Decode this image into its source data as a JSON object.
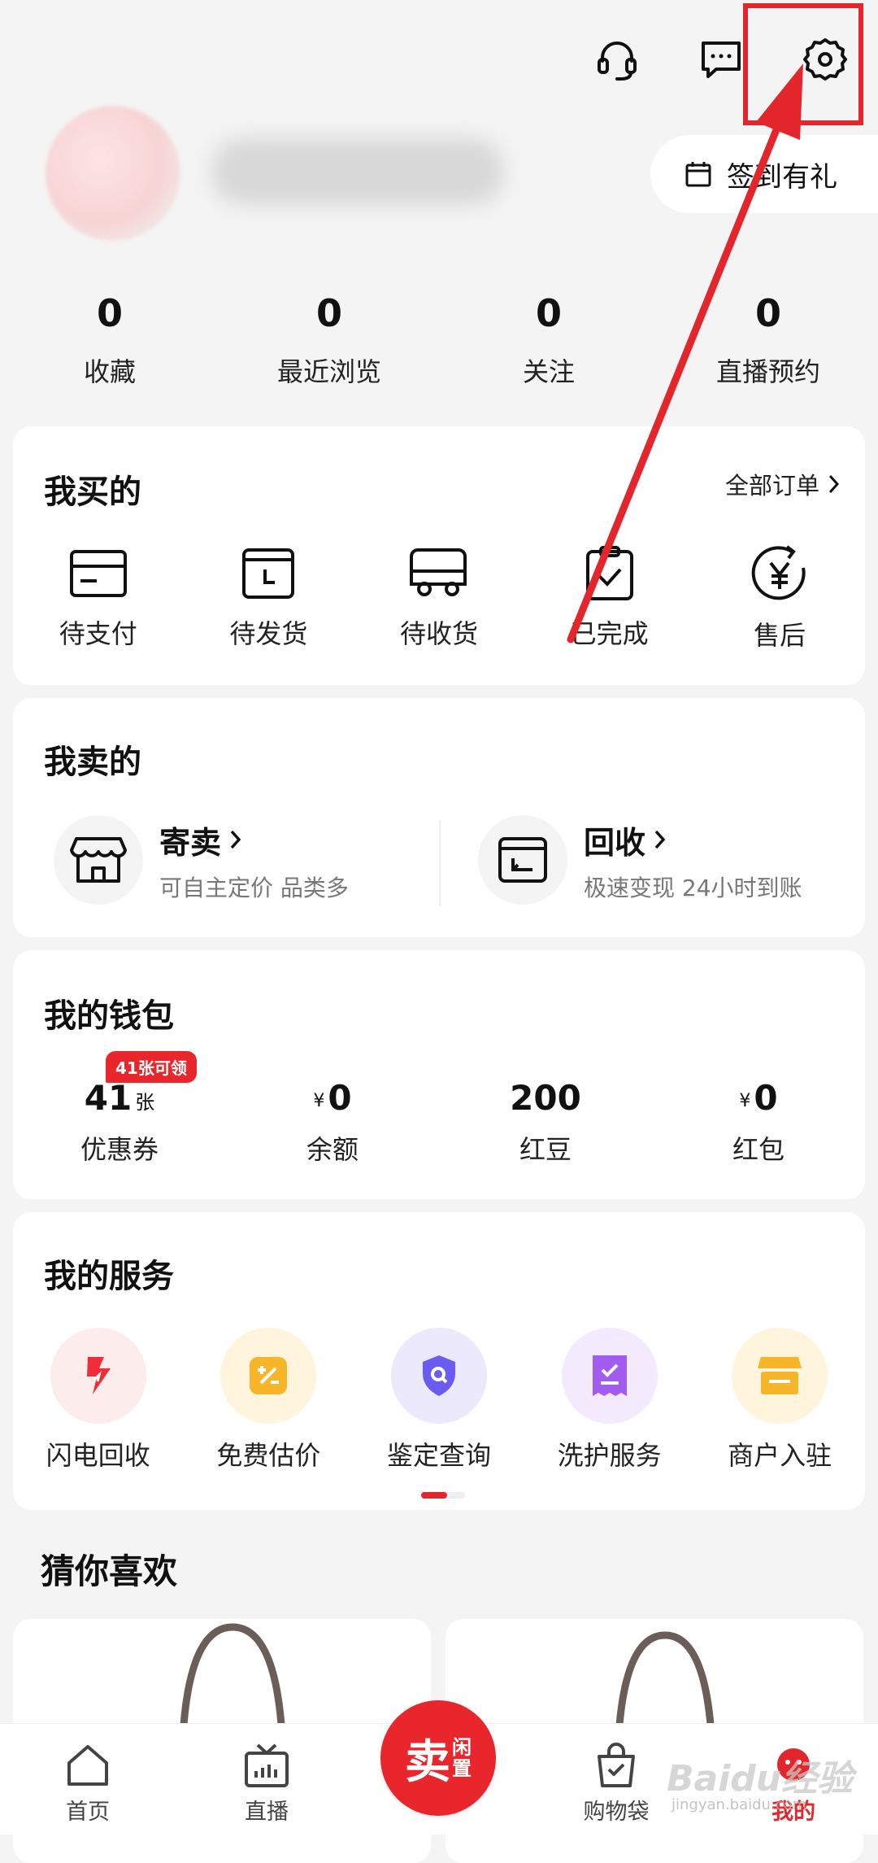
{
  "profile": {
    "signin_label": "签到有礼"
  },
  "stats": [
    {
      "value": "0",
      "label": "收藏"
    },
    {
      "value": "0",
      "label": "最近浏览"
    },
    {
      "value": "0",
      "label": "关注"
    },
    {
      "value": "0",
      "label": "直播预约"
    }
  ],
  "buy": {
    "title": "我买的",
    "all_orders": "全部订单",
    "items": [
      {
        "label": "待支付",
        "icon": "wallet-card-icon"
      },
      {
        "label": "待发货",
        "icon": "box-clock-icon"
      },
      {
        "label": "待收货",
        "icon": "truck-icon"
      },
      {
        "label": "已完成",
        "icon": "clipboard-check-icon"
      },
      {
        "label": "售后",
        "icon": "yen-refresh-icon"
      }
    ]
  },
  "sell": {
    "title": "我卖的",
    "items": [
      {
        "title": "寄卖",
        "subtitle": "可自主定价 品类多",
        "icon": "shop-icon"
      },
      {
        "title": "回收",
        "subtitle": "极速变现 24小时到账",
        "icon": "box-return-icon"
      }
    ]
  },
  "wallet": {
    "title": "我的钱包",
    "coupon_badge": "41张可领",
    "items": [
      {
        "value": "41",
        "unit": "张",
        "currency": "",
        "label": "优惠券"
      },
      {
        "value": "0",
        "unit": "",
        "currency": "¥",
        "label": "余额"
      },
      {
        "value": "200",
        "unit": "",
        "currency": "",
        "label": "红豆"
      },
      {
        "value": "0",
        "unit": "",
        "currency": "¥",
        "label": "红包"
      }
    ]
  },
  "services": {
    "title": "我的服务",
    "items": [
      {
        "label": "闪电回收",
        "icon": "lightning-icon",
        "bg": "#fdecec",
        "color": "#ee2f3a"
      },
      {
        "label": "免费估价",
        "icon": "percent-tag-icon",
        "bg": "#fff4dc",
        "color": "#f7b52a"
      },
      {
        "label": "鉴定查询",
        "icon": "shield-search-icon",
        "bg": "#ece9fd",
        "color": "#6a5cf0"
      },
      {
        "label": "洗护服务",
        "icon": "receipt-check-icon",
        "bg": "#f4eafd",
        "color": "#a35cf0"
      },
      {
        "label": "商户入驻",
        "icon": "store-icon",
        "bg": "#fff4dc",
        "color": "#f7b52a"
      }
    ]
  },
  "guess": {
    "title": "猜你喜欢"
  },
  "nav": {
    "home": "首页",
    "live": "直播",
    "sell_big": "卖",
    "sell_small_1": "闲",
    "sell_small_2": "置",
    "bag": "购物袋",
    "mine": "我的"
  },
  "watermark": {
    "main": "Baidu经验",
    "sub": "jingyan.baidu.com"
  },
  "colors": {
    "accent": "#e3262b",
    "background": "#f4f4f4",
    "card": "#ffffff"
  }
}
